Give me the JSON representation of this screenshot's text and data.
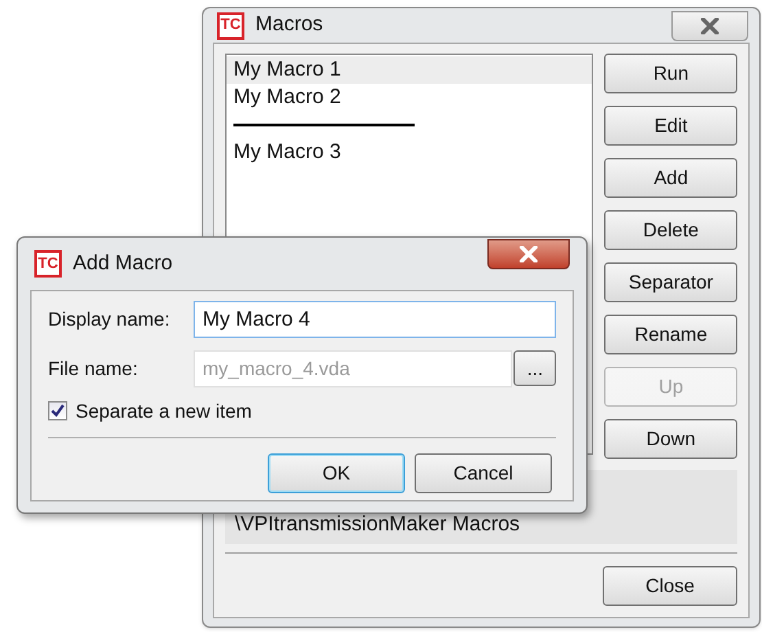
{
  "macros_window": {
    "logo": "TC",
    "title": "Macros",
    "list": [
      {
        "kind": "item",
        "label": "My Macro 1",
        "selected": true
      },
      {
        "kind": "item",
        "label": "My Macro 2",
        "selected": false
      },
      {
        "kind": "separator",
        "selected": false
      },
      {
        "kind": "item",
        "label": "My Macro 3",
        "selected": false
      }
    ],
    "buttons": [
      {
        "label": "Run",
        "disabled": false
      },
      {
        "label": "Edit",
        "disabled": false
      },
      {
        "label": "Add",
        "disabled": false
      },
      {
        "label": "Delete",
        "disabled": false
      },
      {
        "label": "Separator",
        "disabled": false
      },
      {
        "label": "Rename",
        "disabled": false
      },
      {
        "label": "Up",
        "disabled": true
      },
      {
        "label": "Down",
        "disabled": false
      }
    ],
    "path": "\\VPItransmissionMaker Macros",
    "close_button": "Close"
  },
  "add_macro_dialog": {
    "logo": "TC",
    "title": "Add Macro",
    "display_name": {
      "label": "Display name:",
      "value": "My Macro 4",
      "disabled": false
    },
    "file_name": {
      "label": "File name:",
      "value": "my_macro_4.vda",
      "disabled": true
    },
    "browse_button": "...",
    "separate": {
      "label": "Separate a new item",
      "checked": true
    },
    "buttons": [
      {
        "label": "OK",
        "default": true
      },
      {
        "label": "Cancel",
        "default": false
      }
    ]
  }
}
